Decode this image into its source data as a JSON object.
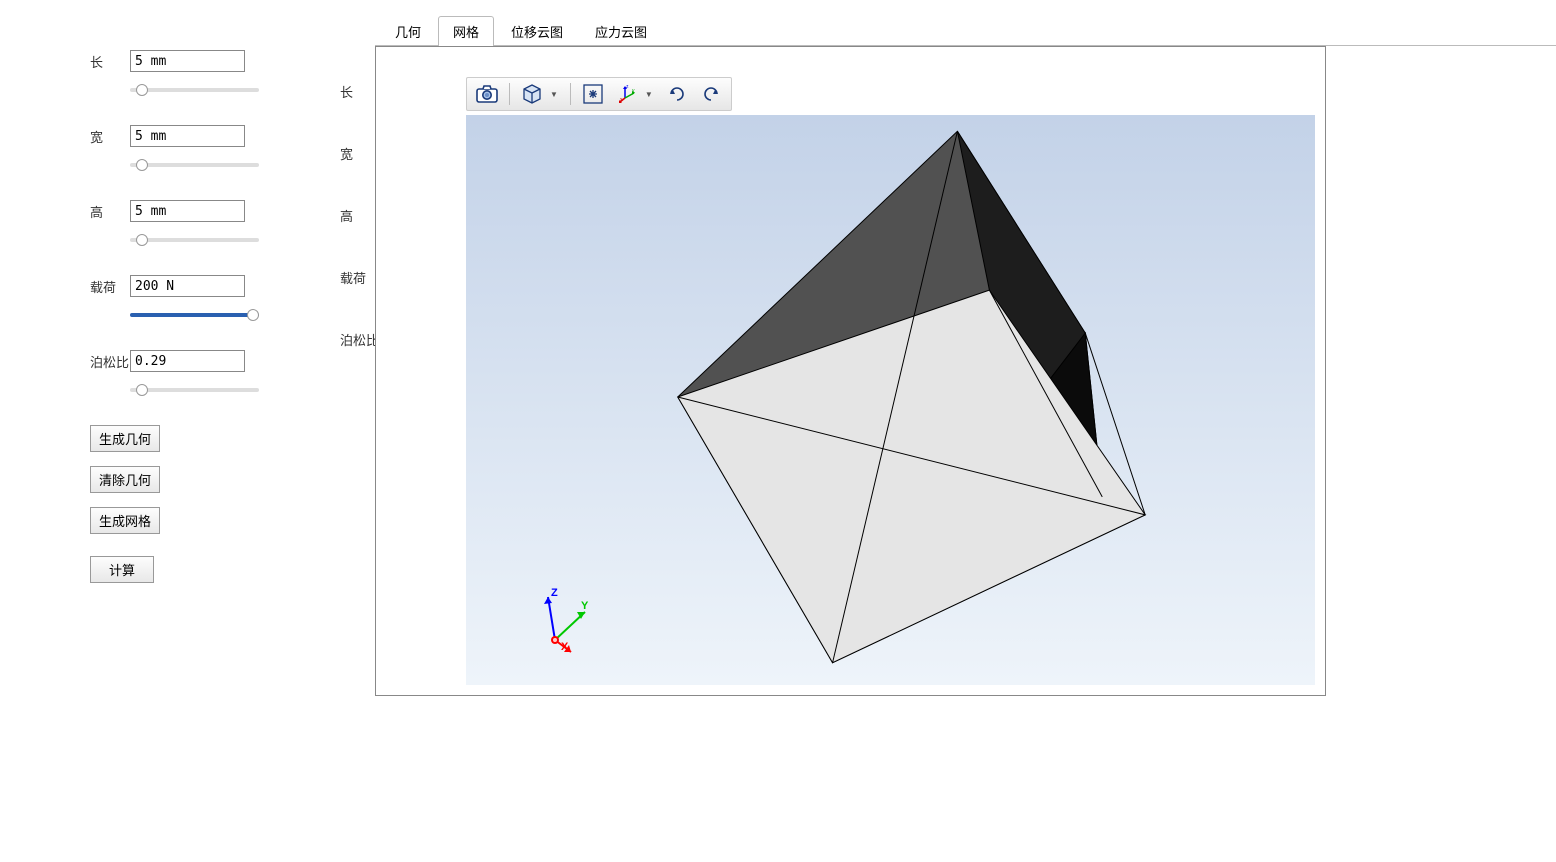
{
  "params": {
    "length": {
      "label": "长",
      "value": "5 mm"
    },
    "width": {
      "label": "宽",
      "value": "5 mm"
    },
    "height": {
      "label": "高",
      "value": "5 mm"
    },
    "load": {
      "label": "载荷",
      "value": "200 N"
    },
    "poisson": {
      "label": "泊松比",
      "value": "0.29"
    }
  },
  "secondary_labels": {
    "length": "长",
    "width": "宽",
    "height": "高",
    "load": "载荷",
    "poisson": "泊松比"
  },
  "buttons": {
    "gen_geom": "生成几何",
    "clear_geom": "清除几何",
    "gen_mesh": "生成网格",
    "compute": "计算"
  },
  "tabs": {
    "geometry": "几何",
    "mesh": "网格",
    "displacement": "位移云图",
    "stress": "应力云图"
  },
  "axis": {
    "x": "X",
    "y": "Y",
    "z": "Z"
  }
}
